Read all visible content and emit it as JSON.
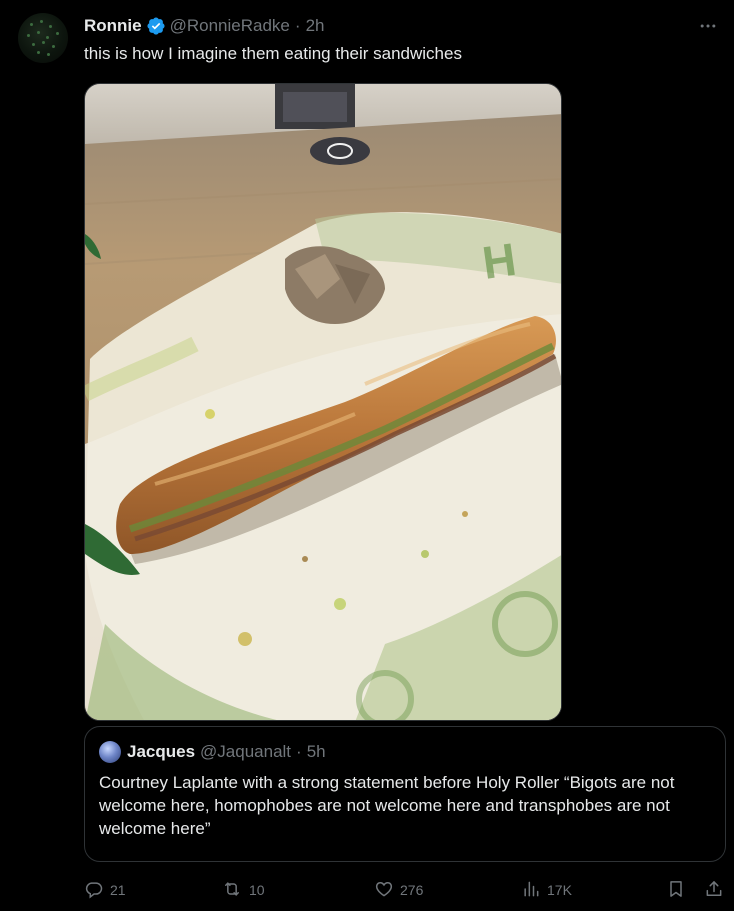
{
  "tweet": {
    "author_name": "Ronnie",
    "author_handle": "@RonnieRadke",
    "separator": "·",
    "time": "2h",
    "text": "this is how I imagine them eating their sandwiches",
    "media_kind": "photo",
    "verified": true
  },
  "quote": {
    "author_name": "Jacques",
    "author_handle": "@Jaquanalt",
    "separator": "·",
    "time": "5h",
    "text": "Courtney Laplante with a strong statement before Holy Roller “Bigots are not welcome here, homophobes are not welcome here and transphobes are not welcome here”"
  },
  "actions": {
    "replies": "21",
    "reposts": "10",
    "likes": "276",
    "views": "17K"
  },
  "icons": {
    "more": "more-horizontal-icon",
    "verified": "verified-badge-icon",
    "reply": "reply-icon",
    "repost": "repost-icon",
    "like": "heart-icon",
    "views": "views-chart-icon",
    "bookmark": "bookmark-icon",
    "share": "share-icon"
  },
  "colors": {
    "background": "#000000",
    "text_primary": "#e7e9ea",
    "text_secondary": "#71767b",
    "border": "#2f3336",
    "verified_blue": "#1d9bf0"
  }
}
